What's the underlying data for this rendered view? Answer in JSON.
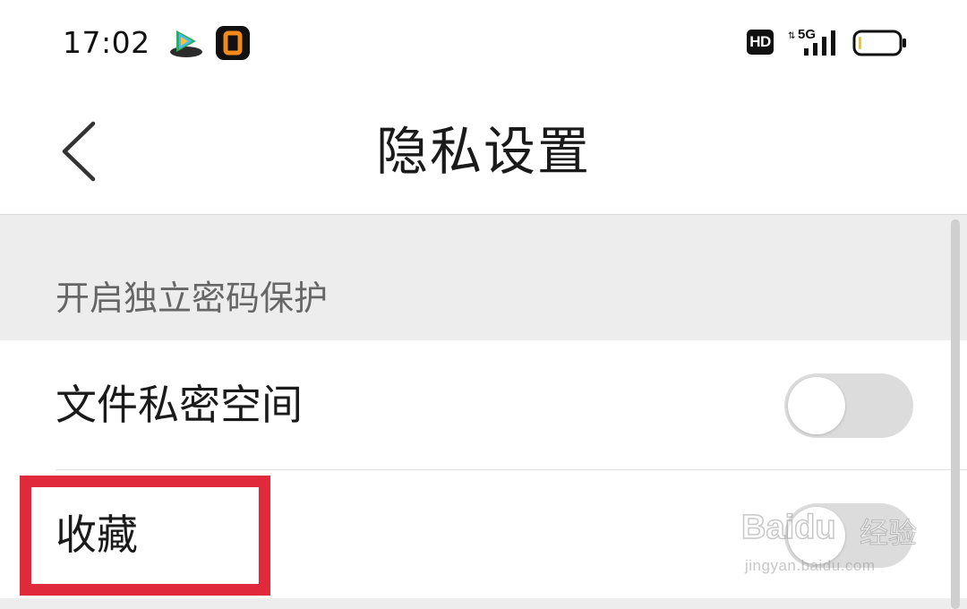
{
  "status_bar": {
    "time": "17:02",
    "app_icons": [
      "video-app-icon",
      "orange-app-icon"
    ],
    "hd_label": "HD",
    "network_label": "5G",
    "signal_icon": "signal-bars-icon",
    "battery_icon": "battery-icon"
  },
  "nav": {
    "back_icon": "chevron-left-icon",
    "title": "隐私设置"
  },
  "section": {
    "title": "开启独立密码保护"
  },
  "rows": [
    {
      "label": "文件私密空间",
      "toggle_on": false
    },
    {
      "label": "收藏",
      "toggle_on": false
    }
  ],
  "annotation": {
    "highlight_color": "#e0293a"
  },
  "watermark": {
    "brand": "Baidu",
    "product": "经验",
    "url": "jingyan.baidu.com"
  },
  "colors": {
    "section_bg": "#ededed",
    "toggle_off": "#dcdcdc"
  }
}
